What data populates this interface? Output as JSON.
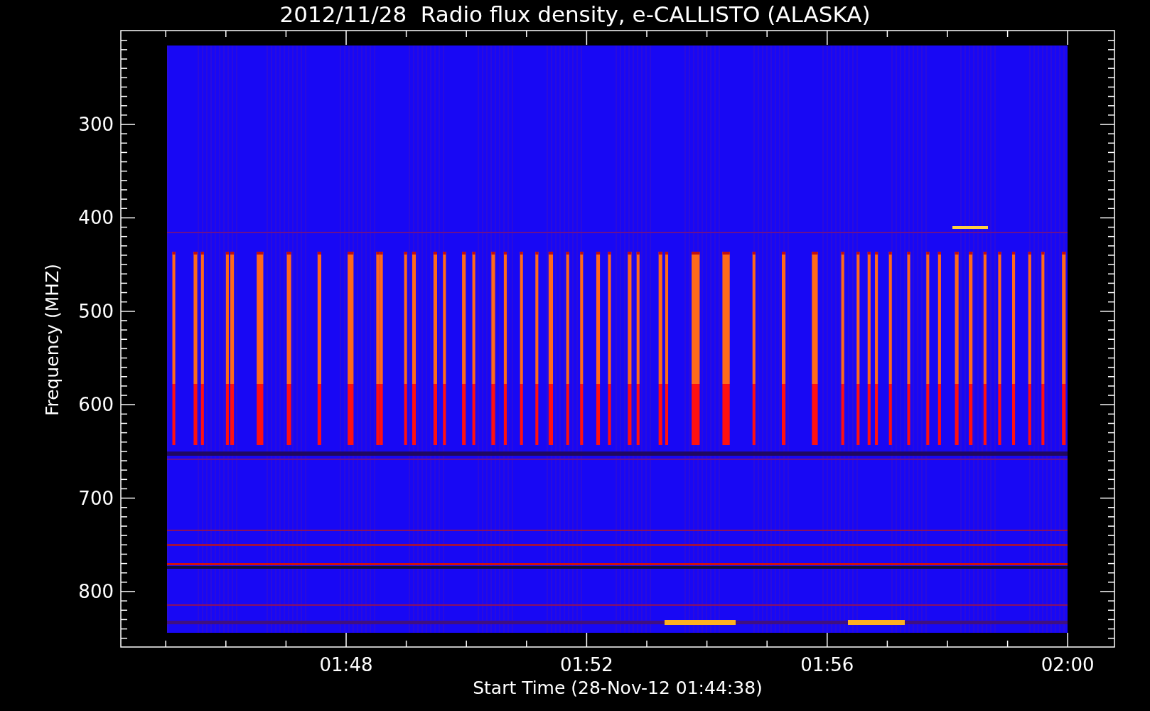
{
  "title": "2012/11/28  Radio flux density, e-CALLISTO (ALASKA)",
  "y_axis": {
    "label": "Frequency (MHZ)",
    "ticks": [
      "300",
      "400",
      "500",
      "600",
      "700",
      "800"
    ]
  },
  "x_axis": {
    "label": "Start Time (28-Nov-12 01:44:38)",
    "ticks": [
      "01:48",
      "01:52",
      "01:56",
      "02:00"
    ]
  }
}
